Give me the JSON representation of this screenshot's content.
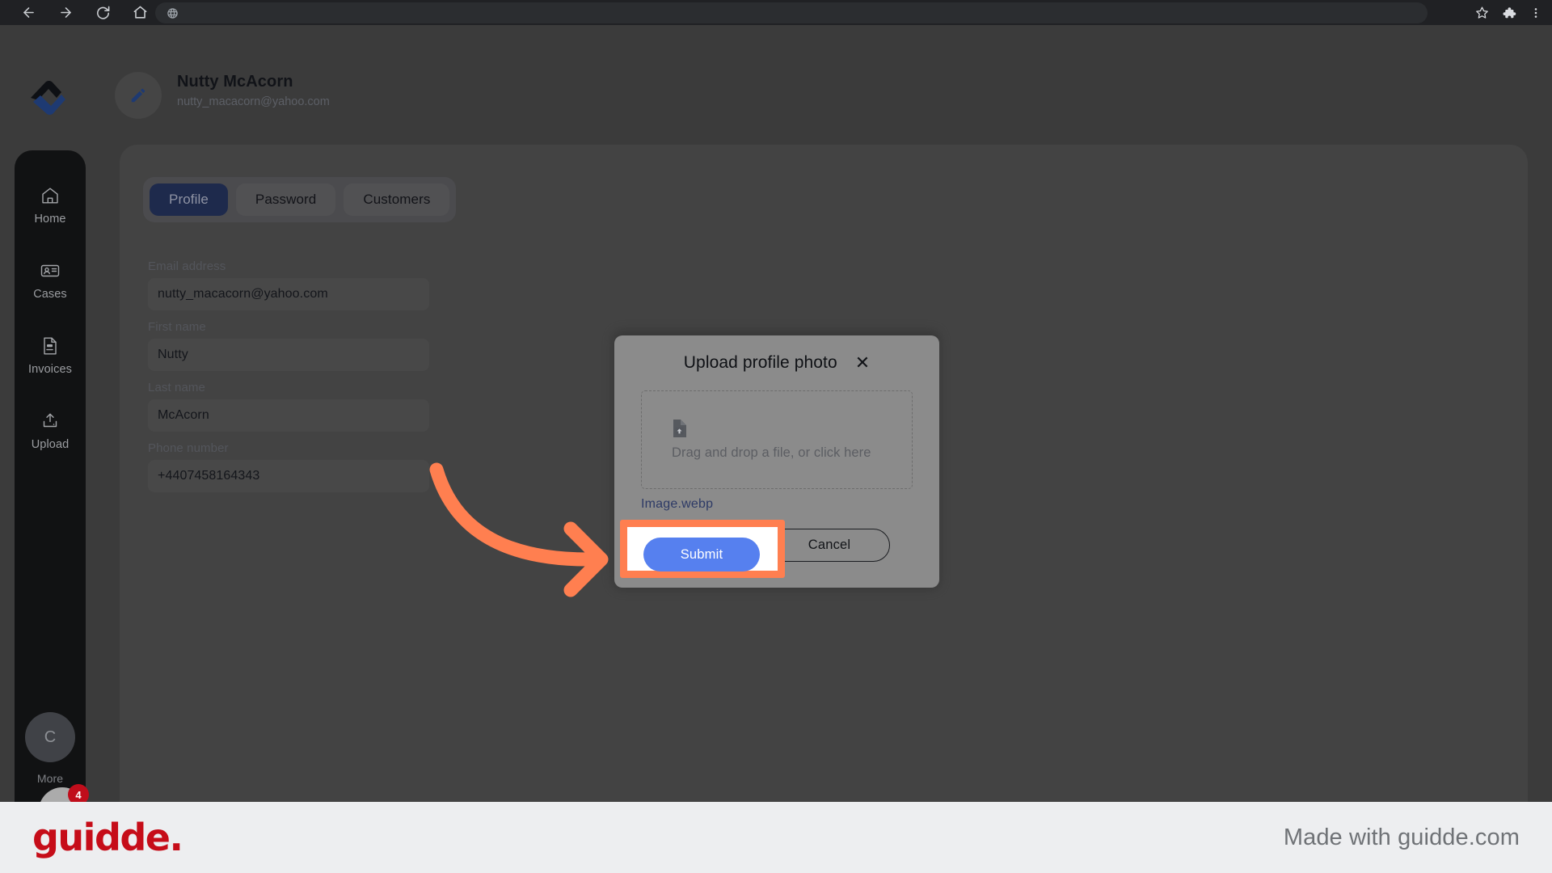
{
  "browser": {
    "back_icon": "arrow-left-icon",
    "forward_icon": "arrow-right-icon",
    "reload_icon": "reload-icon",
    "home_icon": "home-icon",
    "address_value": "",
    "address_placeholder": "",
    "site_icon": "globe-icon",
    "bookmark_icon": "star-icon",
    "extensions_icon": "puzzle-icon",
    "menu_icon": "three-dot-menu-icon"
  },
  "header": {
    "logo_name": "app-logo",
    "edit_icon": "pencil-icon",
    "user_name": "Nutty McAcorn",
    "user_email": "nutty_macacorn@yahoo.com"
  },
  "sidebar": {
    "items": [
      {
        "label": "Home",
        "icon": "home-icon"
      },
      {
        "label": "Cases",
        "icon": "id-card-icon"
      },
      {
        "label": "Invoices",
        "icon": "invoice-document-icon"
      },
      {
        "label": "Upload",
        "icon": "upload-icon"
      }
    ],
    "avatar_initial": "C",
    "bottom_label": "More"
  },
  "guidde_badge": {
    "logo": "g.",
    "count": "4"
  },
  "tabs": [
    {
      "label": "Profile",
      "active": true
    },
    {
      "label": "Password",
      "active": false
    },
    {
      "label": "Customers",
      "active": false
    }
  ],
  "form": {
    "fields": [
      {
        "label": "Email address",
        "value": "nutty_macacorn@yahoo.com",
        "name": "email-field"
      },
      {
        "label": "First name",
        "value": "Nutty",
        "name": "first-name-field"
      },
      {
        "label": "Last name",
        "value": "McAcorn",
        "name": "last-name-field"
      },
      {
        "label": "Phone number",
        "value": "+4407458164343",
        "name": "phone-number-field"
      }
    ]
  },
  "modal": {
    "title": "Upload profile photo",
    "close_icon": "close-x-icon",
    "dropzone_icon": "file-upload-icon",
    "dropzone_text": "Drag and drop a file, or click here",
    "file_name": "Image.webp",
    "submit_label": "Submit",
    "cancel_label": "Cancel"
  },
  "highlight": {
    "submit_label": "Submit",
    "border_color": "#ff7f50",
    "arrow_color": "#ff7f50"
  },
  "footer": {
    "logo": "guidde.",
    "made_with": "Made with guidde.com"
  },
  "colors": {
    "accent_blue": "#5680ef",
    "tab_active_bg": "#1e2a4c",
    "highlight_orange": "#ff7f50",
    "guidde_red": "#c60d19",
    "link_navy": "#2d3a66"
  }
}
